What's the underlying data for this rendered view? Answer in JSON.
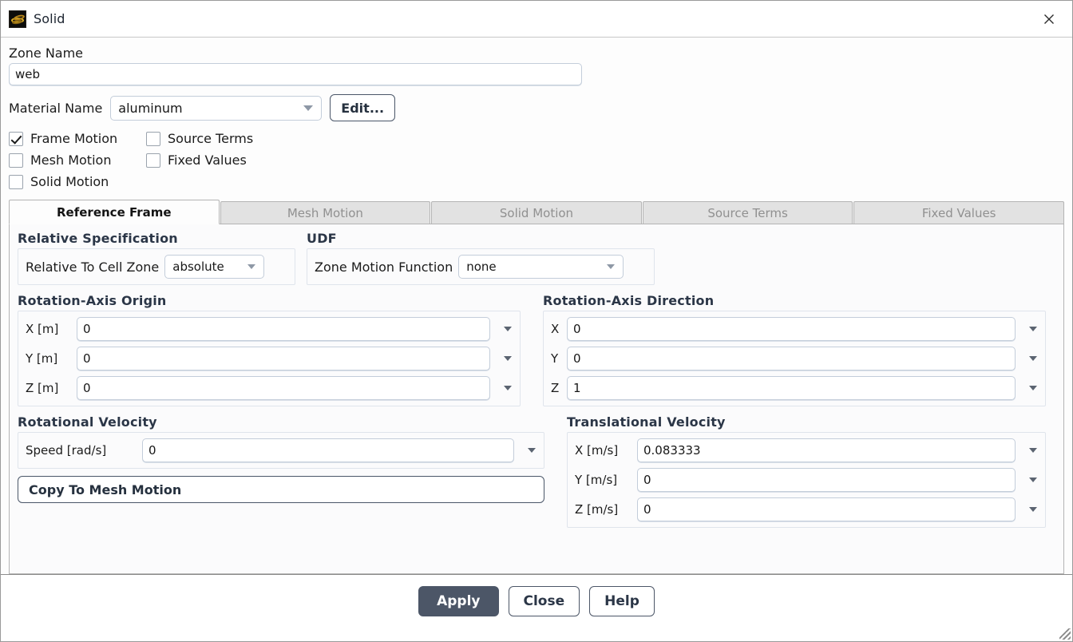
{
  "window": {
    "title": "Solid",
    "icon": "solid-zone-icon",
    "close_icon": "close-icon"
  },
  "zone": {
    "name_label": "Zone Name",
    "name_value": "web",
    "name_placeholder": ""
  },
  "material": {
    "label": "Material Name",
    "value": "aluminum",
    "edit_button": "Edit..."
  },
  "checkboxes": [
    {
      "label": "Frame Motion",
      "checked": true,
      "name": "frame-motion"
    },
    {
      "label": "Source Terms",
      "checked": false,
      "name": "source-terms"
    },
    {
      "label": "Mesh Motion",
      "checked": false,
      "name": "mesh-motion"
    },
    {
      "label": "Fixed Values",
      "checked": false,
      "name": "fixed-values"
    },
    {
      "label": "Solid Motion",
      "checked": false,
      "name": "solid-motion"
    }
  ],
  "tabs": [
    {
      "label": "Reference Frame",
      "active": true
    },
    {
      "label": "Mesh Motion",
      "active": false
    },
    {
      "label": "Solid Motion",
      "active": false
    },
    {
      "label": "Source Terms",
      "active": false
    },
    {
      "label": "Fixed Values",
      "active": false
    }
  ],
  "relative_specification": {
    "title": "Relative Specification",
    "field_label": "Relative To Cell Zone",
    "value": "absolute"
  },
  "udf": {
    "title": "UDF",
    "field_label": "Zone Motion Function",
    "value": "none"
  },
  "rotation_axis_origin": {
    "title": "Rotation-Axis Origin",
    "fields": [
      {
        "label": "X [m]",
        "value": "0"
      },
      {
        "label": "Y [m]",
        "value": "0"
      },
      {
        "label": "Z [m]",
        "value": "0"
      }
    ]
  },
  "rotation_axis_direction": {
    "title": "Rotation-Axis Direction",
    "fields": [
      {
        "label": "X",
        "value": "0"
      },
      {
        "label": "Y",
        "value": "0"
      },
      {
        "label": "Z",
        "value": "1"
      }
    ]
  },
  "rotational_velocity": {
    "title": "Rotational Velocity",
    "speed_label": "Speed [rad/s]",
    "speed_value": "0",
    "copy_button": "Copy To Mesh Motion"
  },
  "translational_velocity": {
    "title": "Translational Velocity",
    "fields": [
      {
        "label": "X [m/s]",
        "value": "0.083333"
      },
      {
        "label": "Y [m/s]",
        "value": "0"
      },
      {
        "label": "Z [m/s]",
        "value": "0"
      }
    ]
  },
  "footer": {
    "apply": "Apply",
    "close": "Close",
    "help": "Help"
  },
  "colors": {
    "accent": "#4c5667",
    "group_title": "#2b3647",
    "input_border": "#c3cdda",
    "tab_inactive_bg": "#e2e2e2",
    "icon_gold": "#c79a1e"
  }
}
